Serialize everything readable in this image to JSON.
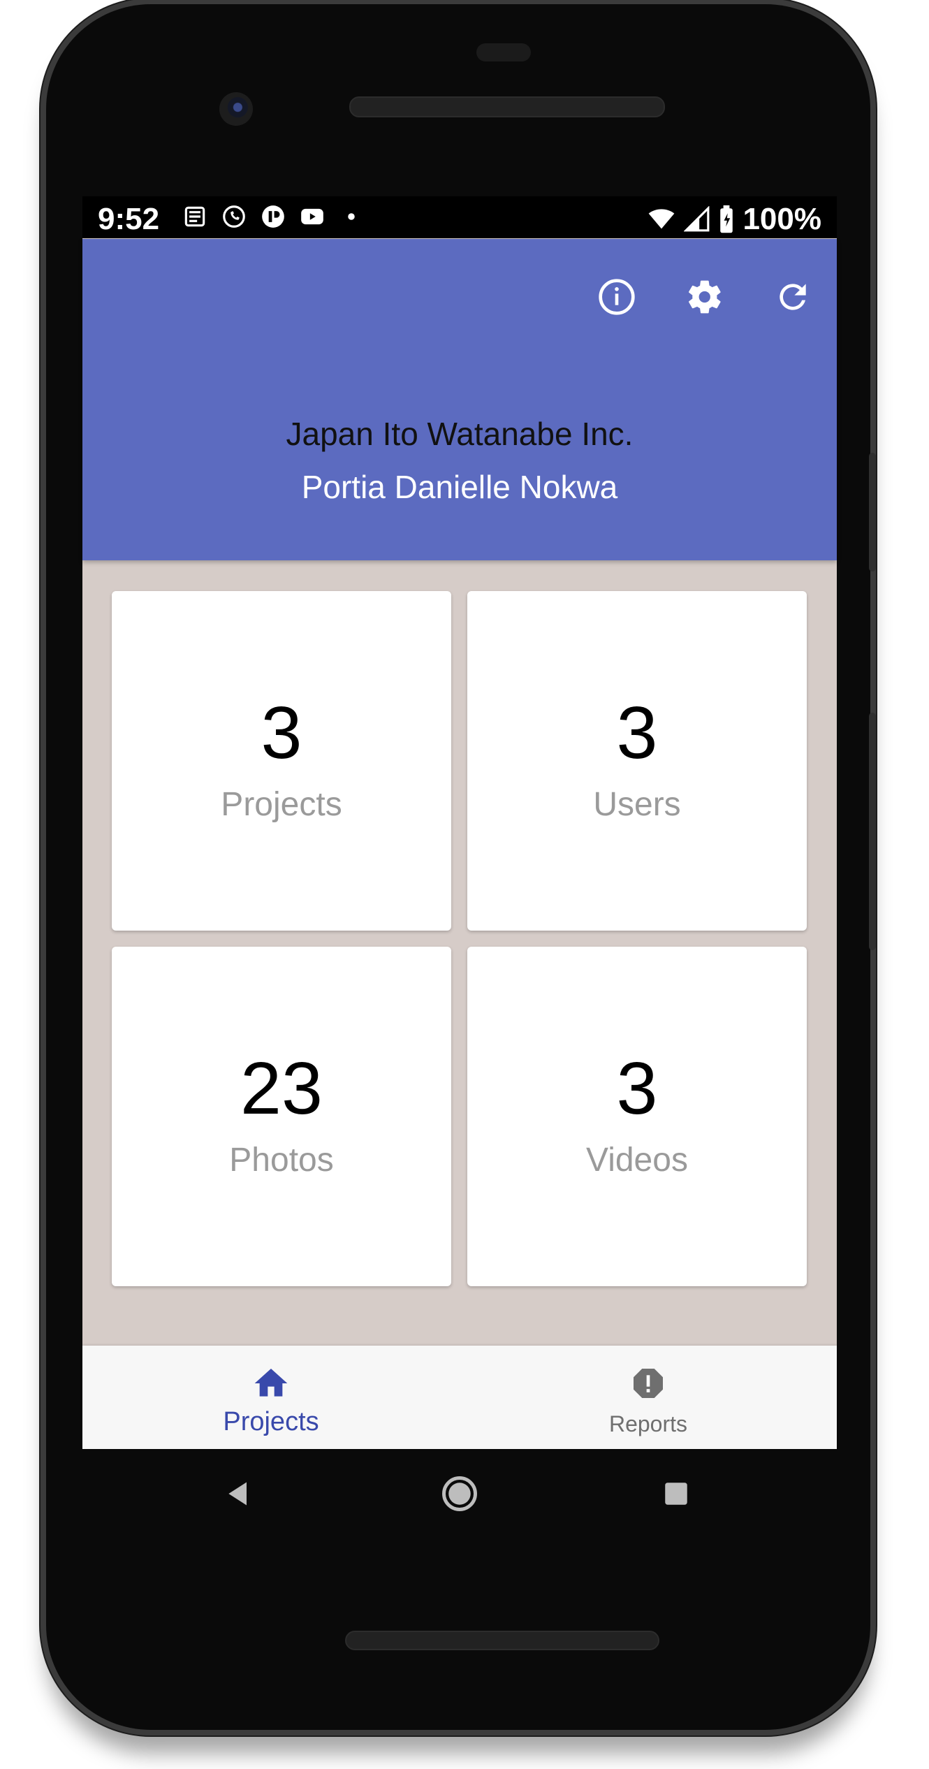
{
  "status_bar": {
    "time": "9:52",
    "notification_icons": [
      "news-icon",
      "whatsapp-icon",
      "app-icon",
      "youtube-icon",
      "dot-icon"
    ],
    "battery_percent": "100%"
  },
  "header": {
    "company_name": "Japan Ito Watanabe Inc.",
    "user_name": "Portia Danielle Nokwa",
    "actions": [
      "info-icon",
      "settings-icon",
      "refresh-icon"
    ]
  },
  "stats": [
    {
      "value": "3",
      "label": "Projects"
    },
    {
      "value": "3",
      "label": "Users"
    },
    {
      "value": "23",
      "label": "Photos"
    },
    {
      "value": "3",
      "label": "Videos"
    }
  ],
  "bottom_nav": [
    {
      "label": "Projects",
      "icon": "home-icon",
      "active": true
    },
    {
      "label": "Reports",
      "icon": "report-icon",
      "active": false
    }
  ],
  "colors": {
    "primary": "#5c6bc0",
    "active_tab": "#3949ab",
    "background": "#d6ccc8"
  }
}
